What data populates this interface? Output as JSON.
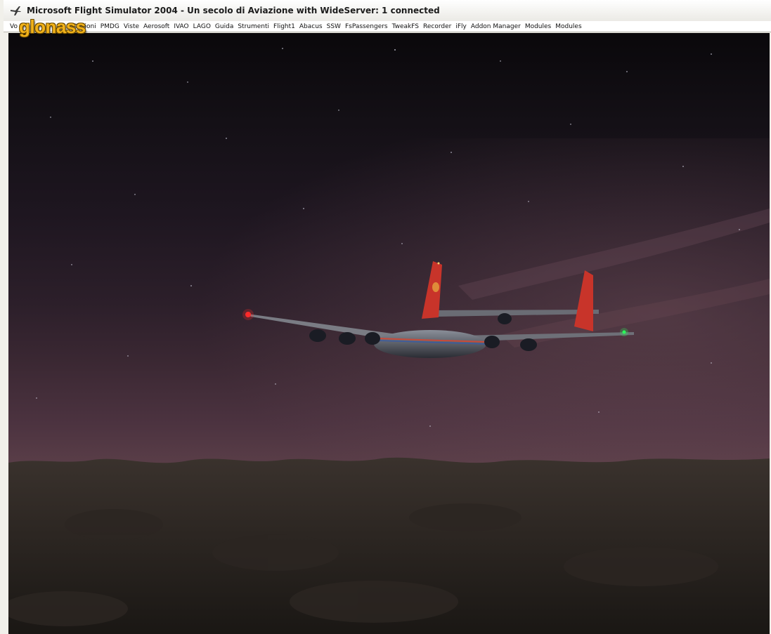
{
  "window": {
    "title": "Microsoft Flight Simulator 2004 - Un secolo di Aviazione with WideServer: 1 connected",
    "app_icon": "airplane-icon"
  },
  "menubar": {
    "items": [
      "Vo",
      "Opzioni",
      "PMDG",
      "Viste",
      "Aerosoft",
      "IVAO",
      "LAGO",
      "Guida",
      "Strumenti",
      "Flight1",
      "Abacus",
      "SSW",
      "FsPassengers",
      "TweakFS",
      "Recorder",
      "iFly",
      "Addon Manager",
      "Modules",
      "Modules"
    ]
  },
  "watermark": {
    "text": "glonass"
  },
  "scene": {
    "sky_top_color": "#0a080b",
    "horizon_color": "#5a3e48",
    "ground_color": "#2a2520",
    "aircraft_livery": "white-red",
    "nav_light_left": "#ff2a2a",
    "nav_light_right": "#2aff5a"
  }
}
